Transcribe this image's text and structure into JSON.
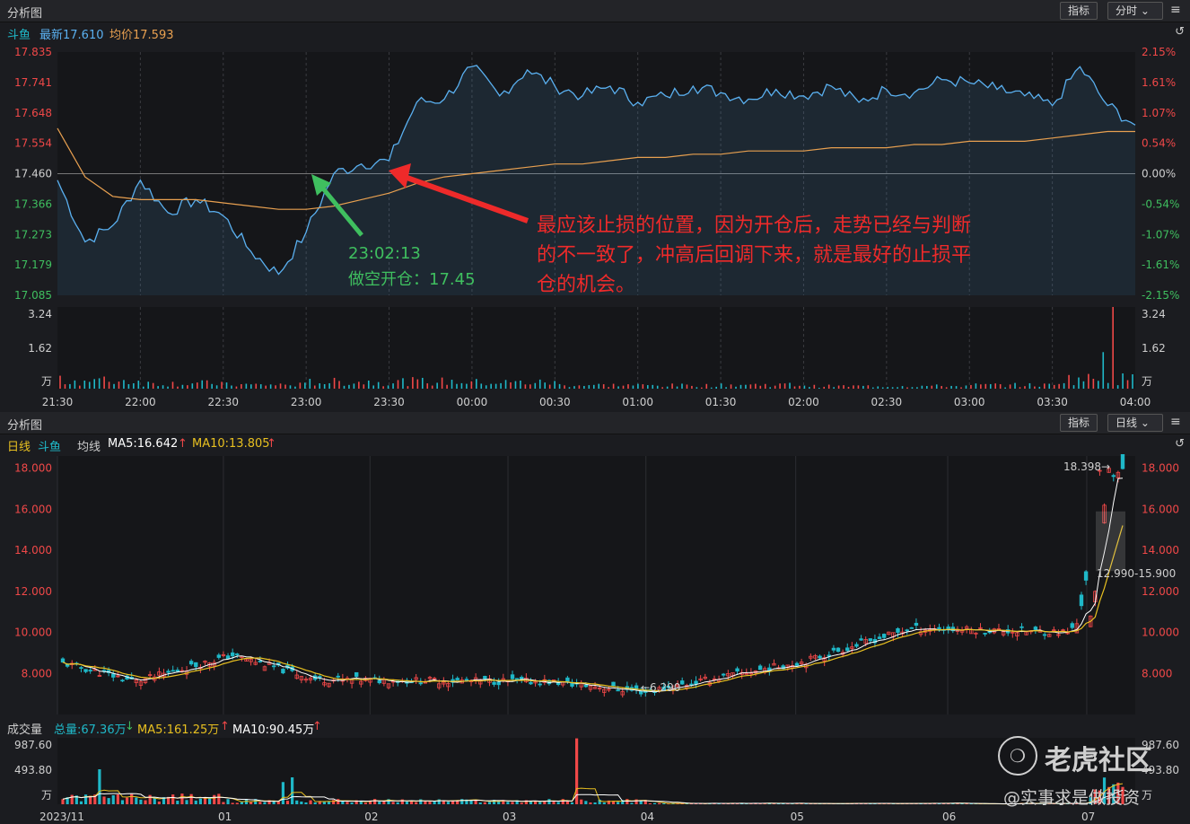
{
  "top_panel": {
    "title": "分析图",
    "btn_indicator": "指标",
    "btn_period": "分时",
    "legend": {
      "name": "斗鱼",
      "latest": "最新17.610",
      "avg": "均价17.593"
    },
    "price_ticks": [
      "17.835",
      "17.741",
      "17.648",
      "17.554",
      "17.460",
      "17.366",
      "17.273",
      "17.179",
      "17.085"
    ],
    "pct_ticks": [
      "2.15%",
      "1.61%",
      "1.07%",
      "0.54%",
      "0.00%",
      "-0.54%",
      "-1.07%",
      "-1.61%",
      "-2.15%"
    ],
    "vol_ticks": [
      "3.24",
      "1.62",
      "万"
    ],
    "time_ticks": [
      "21:30",
      "22:00",
      "22:30",
      "23:00",
      "23:30",
      "00:00",
      "00:30",
      "01:00",
      "01:30",
      "02:00",
      "02:30",
      "03:00",
      "03:30",
      "04:00"
    ],
    "annotation_time": "23:02:13",
    "annotation_trade": "做空开仓：17.45",
    "annotation_note": [
      "最应该止损的位置，因为开仓后，走势已经与判断",
      "的不一致了，冲高后回调下来，就是最好的止损平",
      "仓的机会。"
    ]
  },
  "bottom_panel": {
    "title": "分析图",
    "btn_indicator": "指标",
    "btn_period": "日线",
    "legend": {
      "period": "日线",
      "name": "斗鱼",
      "ma_label": "均线",
      "ma5": "MA5:16.642",
      "ma10": "MA10:13.805"
    },
    "price_ticks": [
      "18.000",
      "16.000",
      "14.000",
      "12.000",
      "10.000",
      "8.000"
    ],
    "high_label": "18.398→",
    "low_label": "←6.290",
    "range_label": "12.990-15.900",
    "vol_legend": {
      "title": "成交量",
      "total": "总量:67.36万",
      "ma5": "MA5:161.25万",
      "ma10": "MA10:90.45万"
    },
    "vol_ticks": [
      "987.60",
      "493.80",
      "万"
    ],
    "date_ticks": [
      "2023/11",
      "01",
      "02",
      "03",
      "04",
      "05",
      "06",
      "07"
    ]
  },
  "watermark": {
    "brand": "老虎社区",
    "handle": "@实事求是做投资"
  },
  "colors": {
    "up": "#f04848",
    "down": "#1fb8c8",
    "price_line": "#5ab0f0",
    "avg_line": "#e8a050",
    "ma5": "#ffffff",
    "ma10": "#e8c020",
    "green": "#3fbf5f"
  },
  "chart_data": [
    {
      "type": "line",
      "title": "",
      "ylim": [
        17.085,
        17.835
      ],
      "x": [
        "21:30",
        "21:40",
        "21:50",
        "22:00",
        "22:10",
        "22:20",
        "22:30",
        "22:40",
        "22:50",
        "23:00",
        "23:10",
        "23:20",
        "23:30",
        "23:40",
        "23:50",
        "00:00",
        "00:10",
        "00:20",
        "00:30",
        "00:40",
        "00:50",
        "01:00",
        "01:10",
        "01:20",
        "01:30",
        "01:40",
        "01:50",
        "02:00",
        "02:10",
        "02:20",
        "02:30",
        "02:40",
        "02:50",
        "03:00",
        "03:10",
        "03:20",
        "03:30",
        "03:40",
        "03:50",
        "04:00"
      ],
      "series": [
        {
          "values": [
            17.44,
            17.25,
            17.3,
            17.44,
            17.34,
            17.38,
            17.33,
            17.22,
            17.15,
            17.28,
            17.46,
            17.49,
            17.5,
            17.68,
            17.69,
            17.79,
            17.7,
            17.78,
            17.73,
            17.7,
            17.73,
            17.68,
            17.7,
            17.73,
            17.71,
            17.69,
            17.72,
            17.7,
            17.73,
            17.68,
            17.72,
            17.71,
            17.75,
            17.74,
            17.72,
            17.7,
            17.67,
            17.79,
            17.67,
            17.61
          ]
        },
        {
          "values": [
            17.6,
            17.45,
            17.39,
            17.38,
            17.38,
            17.38,
            17.37,
            17.36,
            17.35,
            17.35,
            17.36,
            17.38,
            17.4,
            17.43,
            17.45,
            17.46,
            17.47,
            17.48,
            17.49,
            17.49,
            17.5,
            17.51,
            17.51,
            17.52,
            17.52,
            17.53,
            17.53,
            17.53,
            17.54,
            17.54,
            17.54,
            17.55,
            17.55,
            17.56,
            17.56,
            17.56,
            17.57,
            17.58,
            17.59,
            17.59
          ]
        }
      ]
    },
    {
      "type": "bar",
      "title": "",
      "ylim": [
        0,
        3.24
      ],
      "categories": [
        "21:30",
        "22:00",
        "22:30",
        "23:00",
        "23:30",
        "00:00",
        "00:30",
        "01:00",
        "01:30",
        "02:00",
        "02:30",
        "03:00",
        "03:30",
        "04:00"
      ],
      "values": [
        0.45,
        0.3,
        0.22,
        0.38,
        0.4,
        0.35,
        0.2,
        0.18,
        0.22,
        0.14,
        0.15,
        0.2,
        0.55,
        3.24
      ]
    },
    {
      "type": "line",
      "title": "",
      "ylim": [
        6.0,
        18.6
      ],
      "x": [
        "2023/11",
        "12",
        "01",
        "02",
        "03",
        "04",
        "05",
        "06",
        "07"
      ],
      "series": [
        {
          "values": [
            8.5,
            7.6,
            8.9,
            7.7,
            7.6,
            7.1,
            8.6,
            10.2,
            10.0,
            18.0
          ]
        },
        {
          "values": [
            8.8,
            7.7,
            8.4,
            7.8,
            7.6,
            7.3,
            8.3,
            10.0,
            10.0,
            16.6
          ]
        },
        {
          "values": [
            8.9,
            7.8,
            8.2,
            7.8,
            7.6,
            7.4,
            8.1,
            9.8,
            9.9,
            13.8
          ]
        }
      ]
    },
    {
      "type": "bar",
      "title": "",
      "ylim": [
        0,
        987.6
      ],
      "categories": [
        "2023/11",
        "01",
        "02",
        "03",
        "04",
        "05",
        "06",
        "07"
      ],
      "values": [
        520,
        330,
        90,
        80,
        980,
        40,
        30,
        400
      ]
    }
  ]
}
